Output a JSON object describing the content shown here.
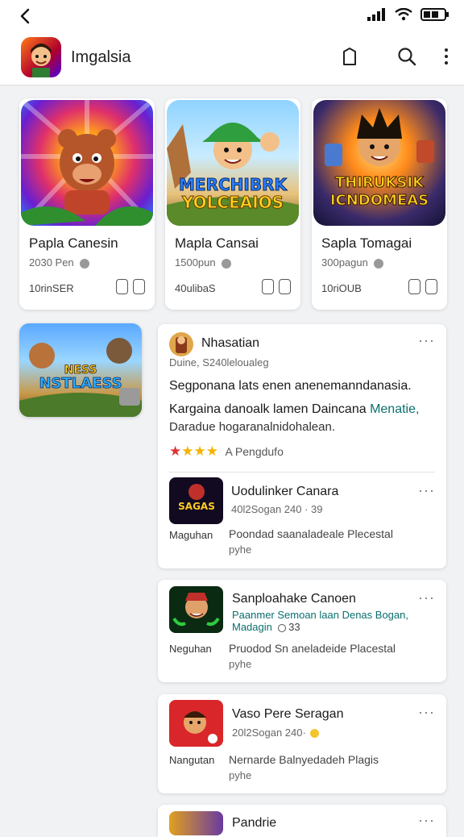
{
  "header": {
    "title": "Imgalsia"
  },
  "top_cards": [
    {
      "name": "Papla Canesin",
      "sub": "2030 Pen",
      "meta": "10rinSER"
    },
    {
      "name": "Mapla Cansai",
      "sub": "1500pun",
      "meta": "40ulibaS"
    },
    {
      "name": "Sapla Tomagai",
      "sub": "300pagun",
      "meta": "10riOUB"
    }
  ],
  "art_text": {
    "card2": "MERCHIBRK YOLCEAIOS",
    "card3": "THIRUKSIK ICNDOMEAS",
    "side": "NESS NSTLAESS"
  },
  "featured": {
    "title": "Nhasatian",
    "subtitle": "Duine, S240leloualeg",
    "headline": "Segponana lats enen anenemanndanasia.",
    "line2_main": "Kargaina danoalk lamen Daincana",
    "line2_link": "Menatie,",
    "line3": "Daradue hogaranalnidohalean.",
    "rating_text": "A Pengdufo",
    "rating_stars": 4
  },
  "list_items": [
    {
      "title": "Uodulinker Canara",
      "sub": "40l2Sogan 240 · 39",
      "left_label": "Maguhan",
      "desc1": "Poondad saanaladeale Plecestal",
      "desc2": "pyhe"
    },
    {
      "title": "Sanploahake Canoen",
      "link": "Paanmer Semoan laan Denas Bogan,",
      "sub2": "Madagin",
      "sub2_count": "33",
      "left_label": "Neguhan",
      "desc1": "Pruodod Sn aneladeide Placestal",
      "desc2": "pyhe"
    },
    {
      "title": "Vaso Pere Seragan",
      "sub": "20l2Sogan 240·",
      "left_label": "Nangutan",
      "desc1": "Nernarde Balnyedadeh Plagis",
      "desc2": "pyhe"
    },
    {
      "title": "Pandrie"
    }
  ],
  "colors": {
    "link": "#0b6e6e",
    "star": "#f4b400",
    "star_empty": "#dd3333"
  }
}
